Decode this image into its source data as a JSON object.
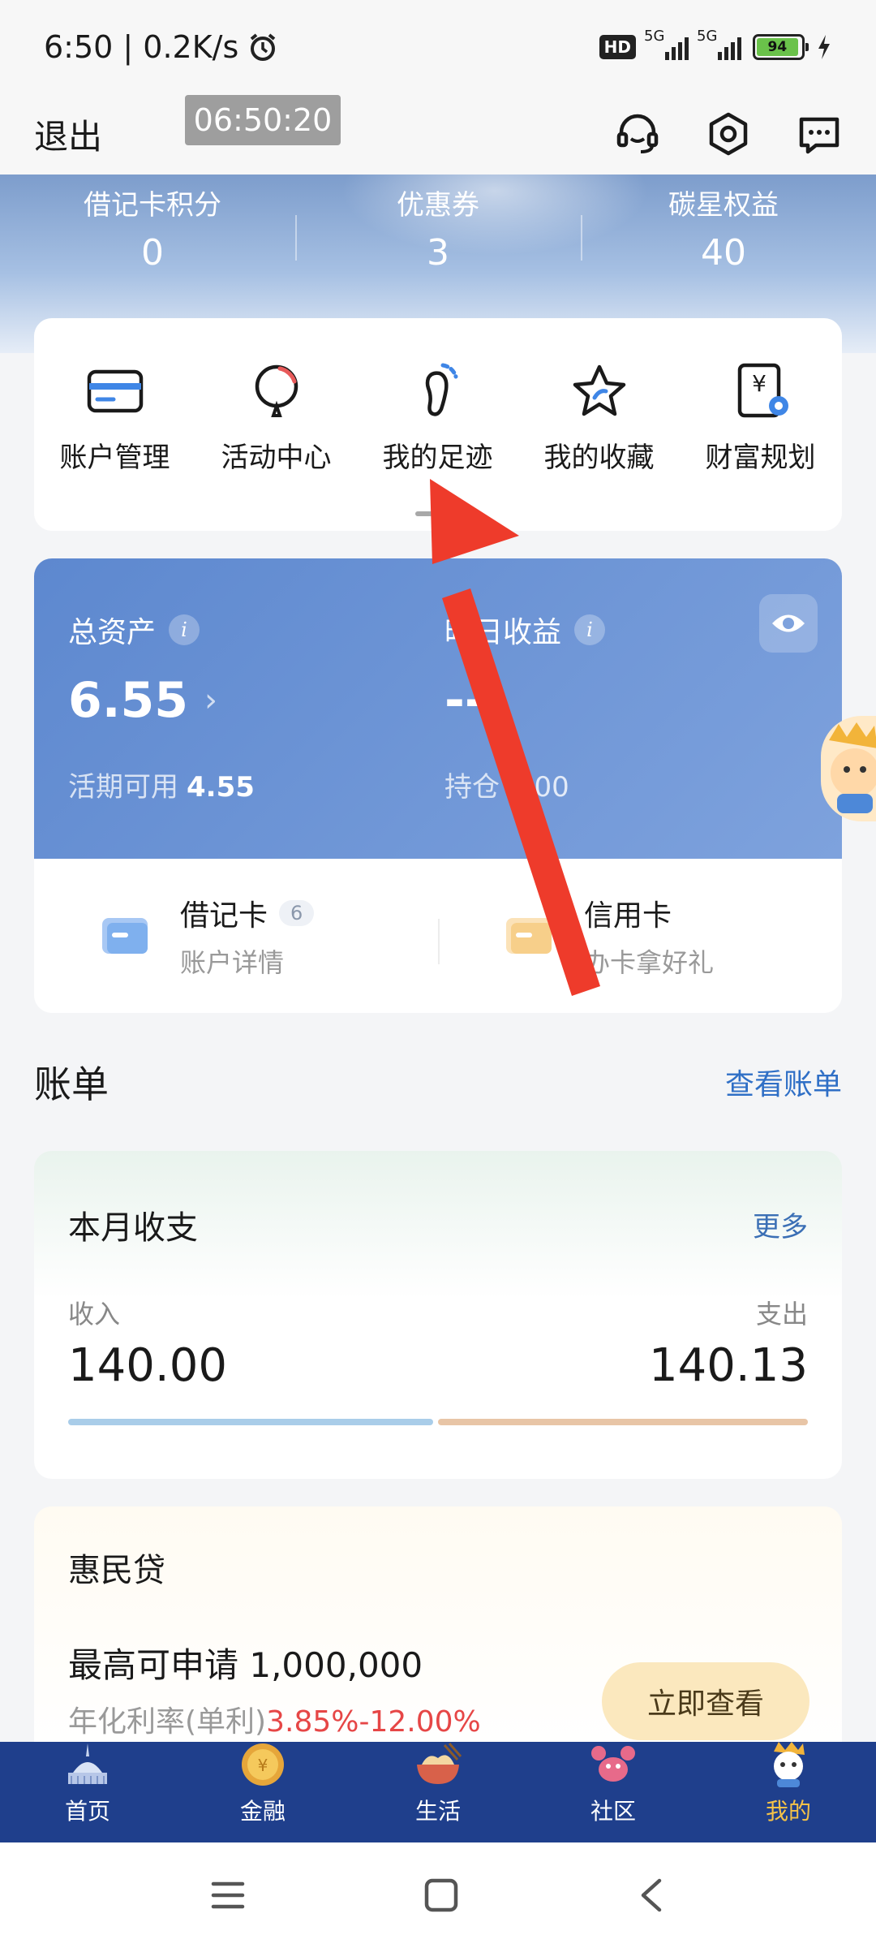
{
  "status_bar": {
    "time_speed": "6:50 | 0.2K/s",
    "hd_label": "HD",
    "network_1": "5G",
    "network_2": "5G",
    "battery": "94"
  },
  "header": {
    "logout_label": "退出",
    "timer": "06:50:20"
  },
  "stats": [
    {
      "label": "借记卡积分",
      "value": "0"
    },
    {
      "label": "优惠券",
      "value": "3"
    },
    {
      "label": "碳星权益",
      "value": "40"
    }
  ],
  "quick_menu": [
    {
      "label": "账户管理",
      "icon": "card-icon"
    },
    {
      "label": "活动中心",
      "icon": "balloon-icon"
    },
    {
      "label": "我的足迹",
      "icon": "footprint-icon"
    },
    {
      "label": "我的收藏",
      "icon": "star-icon"
    },
    {
      "label": "财富规划",
      "icon": "wealth-icon"
    }
  ],
  "assets": {
    "total_label": "总资产",
    "total_value": "6.55",
    "current_label": "活期可用",
    "current_value": "4.55",
    "yesterday_label": "昨日收益",
    "yesterday_value": "--",
    "holding_label": "持仓",
    "holding_value": "0.00"
  },
  "cards": [
    {
      "title": "借记卡",
      "badge": "6",
      "sub": "账户详情"
    },
    {
      "title": "信用卡",
      "sub": "办卡拿好礼"
    }
  ],
  "bill": {
    "section_title": "账单",
    "section_link": "查看账单",
    "card_title": "本月收支",
    "more": "更多",
    "income_label": "收入",
    "income_value": "140.00",
    "expense_label": "支出",
    "expense_value": "140.13",
    "income_ratio": 0.5,
    "expense_ratio": 0.5
  },
  "loan": {
    "title": "惠民贷",
    "max_amount": "最高可申请 1,000,000",
    "rate_label": "年化利率(单利)",
    "rate_value": "3.85%-12.00%",
    "button": "立即查看"
  },
  "tabs": [
    {
      "label": "首页",
      "active": false
    },
    {
      "label": "金融",
      "active": false
    },
    {
      "label": "生活",
      "active": false
    },
    {
      "label": "社区",
      "active": false
    },
    {
      "label": "我的",
      "active": true
    }
  ],
  "colors": {
    "accent_blue": "#2f6fc6",
    "asset_card": "#6b93d6",
    "tabbar": "#1f3f8c",
    "active_tab": "#f5c248",
    "rate_red": "#e64646",
    "arrow_red": "#ee3b2b"
  }
}
